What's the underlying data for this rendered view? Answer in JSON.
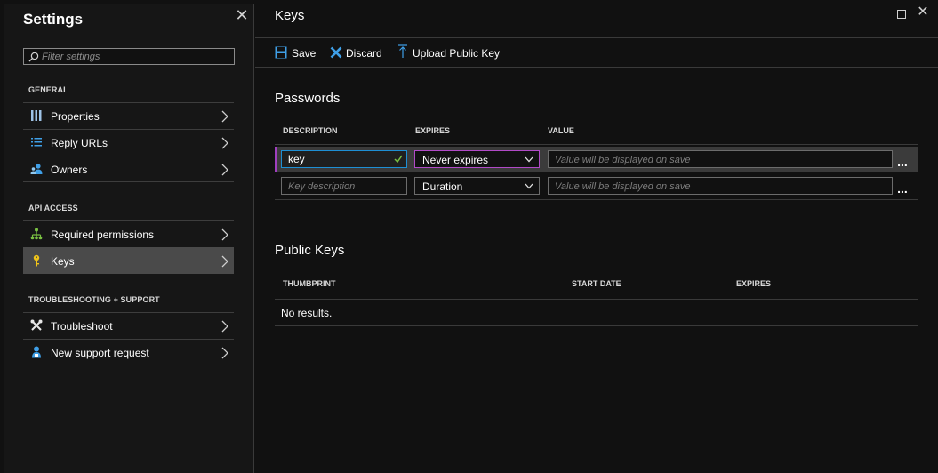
{
  "settings": {
    "title": "Settings",
    "close_glyph": "✕",
    "filter_placeholder": "Filter settings",
    "groups": [
      {
        "heading": "GENERAL",
        "items": [
          {
            "label": "Properties",
            "icon": "properties-icon"
          },
          {
            "label": "Reply URLs",
            "icon": "list-icon"
          },
          {
            "label": "Owners",
            "icon": "users-icon"
          }
        ]
      },
      {
        "heading": "API ACCESS",
        "items": [
          {
            "label": "Required permissions",
            "icon": "hierarchy-icon"
          },
          {
            "label": "Keys",
            "icon": "key-icon",
            "selected": true
          }
        ]
      },
      {
        "heading": "TROUBLESHOOTING + SUPPORT",
        "items": [
          {
            "label": "Troubleshoot",
            "icon": "wrench-icon"
          },
          {
            "label": "New support request",
            "icon": "person-icon"
          }
        ]
      }
    ]
  },
  "keys": {
    "title": "Keys",
    "close_glyph": "✕",
    "toolbar": {
      "save_label": "Save",
      "discard_label": "Discard",
      "upload_label": "Upload Public Key"
    },
    "passwords": {
      "title": "Passwords",
      "columns": [
        "DESCRIPTION",
        "EXPIRES",
        "VALUE"
      ],
      "rows": [
        {
          "description_value": "key",
          "description_placeholder": "Key description",
          "expires": "Never expires",
          "value_placeholder": "Value will be displayed on save",
          "more": "..."
        },
        {
          "description_value": "",
          "description_placeholder": "Key description",
          "expires": "Duration",
          "value_placeholder": "Value will be displayed on save",
          "more": "..."
        }
      ]
    },
    "public_keys": {
      "title": "Public Keys",
      "columns": [
        "THUMBPRINT",
        "START DATE",
        "EXPIRES"
      ],
      "empty_text": "No results."
    }
  },
  "colors": {
    "accent_blue": "#1e8fd4",
    "selected_purple": "#a03fbf",
    "key_icon": "#f0c419",
    "permissions_icon": "#7ac142"
  }
}
